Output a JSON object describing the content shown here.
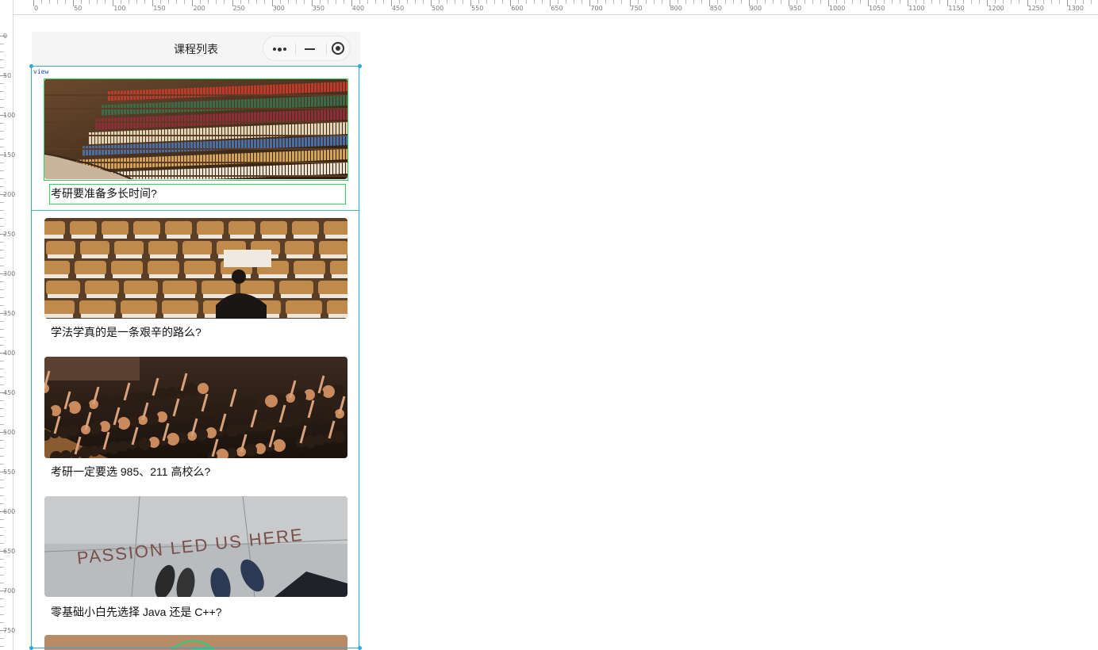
{
  "ruler": {
    "top_labels": [
      "0",
      "50",
      "100",
      "150",
      "200",
      "250",
      "300",
      "350",
      "400",
      "450",
      "500",
      "550",
      "600",
      "650",
      "700",
      "750",
      "800",
      "850",
      "900",
      "950",
      "1000",
      "1050",
      "1100",
      "1150",
      "1200",
      "1250",
      "1300"
    ],
    "left_labels": [
      "0",
      "50",
      "100",
      "150",
      "200",
      "250",
      "300",
      "350",
      "400",
      "450",
      "500",
      "550",
      "600",
      "650",
      "700",
      "750"
    ]
  },
  "navbar": {
    "title": "课程列表"
  },
  "overlay": {
    "tag": "view"
  },
  "courses": [
    {
      "title": "考研要准备多长时间?",
      "image": "library-bookshelves-photo"
    },
    {
      "title": "学法学真的是一条艰辛的路么?",
      "image": "lecture-hall-reader-photo"
    },
    {
      "title": "考研一定要选 985、211 高校么?",
      "image": "raised-hands-crowd-photo"
    },
    {
      "title": "零基础小白先选择 Java 还是 C++?",
      "image": "passion-led-us-here-photo"
    },
    {
      "title": "",
      "image": "neon-sign-photo"
    }
  ],
  "colors": {
    "selection": "#29a9e0",
    "debug_green": "#2fd35a",
    "navbar_bg": "#f5f5f5"
  },
  "image_texts": {
    "passion": "PASSION LED US HERE"
  }
}
